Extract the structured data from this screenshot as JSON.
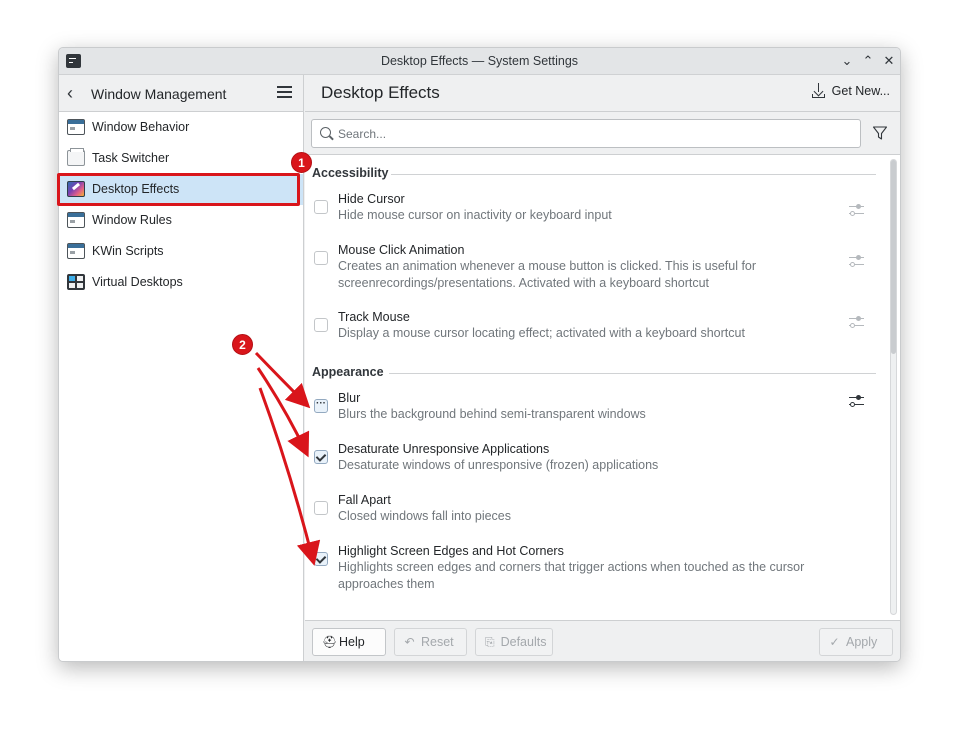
{
  "window": {
    "title": "Desktop Effects — System Settings",
    "controls": {
      "minimize": "⌄",
      "maximize": "⌃",
      "close": "✕"
    }
  },
  "sidebar": {
    "back_icon": "chevron-left-icon",
    "title": "Window Management",
    "items": [
      {
        "label": "Window Behavior",
        "icon": "window-behavior-icon"
      },
      {
        "label": "Task Switcher",
        "icon": "task-switcher-icon"
      },
      {
        "label": "Desktop Effects",
        "icon": "desktop-effects-icon",
        "active": true
      },
      {
        "label": "Window Rules",
        "icon": "window-rules-icon"
      },
      {
        "label": "KWin Scripts",
        "icon": "kwin-scripts-icon"
      },
      {
        "label": "Virtual Desktops",
        "icon": "virtual-desktops-icon"
      }
    ]
  },
  "main": {
    "title": "Desktop Effects",
    "get_new_label": "Get New...",
    "search_placeholder": "Search..."
  },
  "sections": [
    {
      "label": "Accessibility",
      "effects": [
        {
          "name": "Hide Cursor",
          "description": "Hide mouse cursor on inactivity or keyboard input",
          "state": "unchecked"
        },
        {
          "name": "Mouse Click Animation",
          "description": "Creates an animation whenever a mouse button is clicked. This is useful for screenrecordings/presentations. Activated with a keyboard shortcut",
          "state": "unchecked"
        },
        {
          "name": "Track Mouse",
          "description": "Display a mouse cursor locating effect; activated with a keyboard shortcut",
          "state": "unchecked"
        }
      ]
    },
    {
      "label": "Appearance",
      "effects": [
        {
          "name": "Blur",
          "description": "Blurs the background behind semi-transparent windows",
          "state": "partial"
        },
        {
          "name": "Desaturate Unresponsive Applications",
          "description": "Desaturate windows of unresponsive (frozen) applications",
          "state": "checked"
        },
        {
          "name": "Fall Apart",
          "description": "Closed windows fall into pieces",
          "state": "unchecked"
        },
        {
          "name": "Highlight Screen Edges and Hot Corners",
          "description": "Highlights screen edges and corners that trigger actions when touched as the cursor approaches them",
          "state": "checked"
        }
      ]
    }
  ],
  "footer": {
    "help": "Help",
    "reset": "Reset",
    "defaults": "Defaults",
    "apply": "Apply"
  },
  "annotations": {
    "badge_1": "1",
    "badge_2": "2",
    "color": "#d9151b"
  },
  "colors": {
    "selection": "#cde4f7",
    "window_bg": "#eff0f1"
  }
}
